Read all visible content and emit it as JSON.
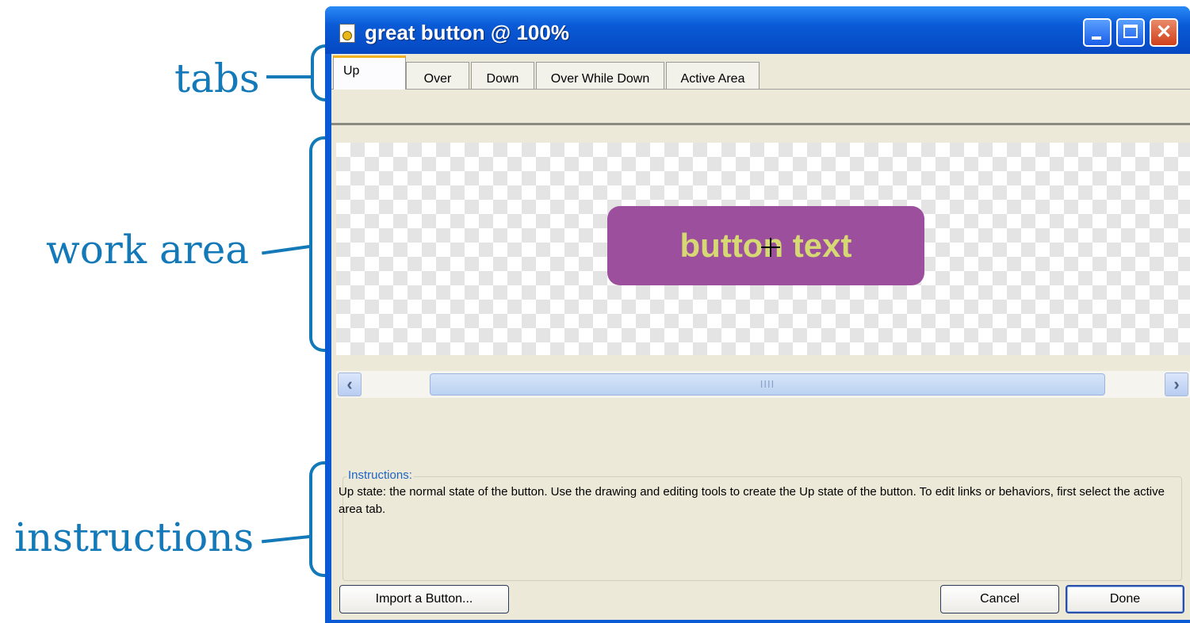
{
  "callouts": {
    "tabs": "tabs",
    "work_area": "work area",
    "instructions": "instructions"
  },
  "window": {
    "title": "great button @  100%",
    "controls": {
      "minimize": "minimize",
      "maximize": "maximize",
      "close": "✕"
    }
  },
  "tabs": [
    {
      "label": "Up",
      "active": true
    },
    {
      "label": "Over"
    },
    {
      "label": "Down"
    },
    {
      "label": "Over While Down"
    },
    {
      "label": "Active Area"
    }
  ],
  "work_area": {
    "button_text": "button text",
    "button_color": "#9c4f9c",
    "text_color": "#d6d873"
  },
  "scrollbar": {
    "left_arrow": "‹",
    "right_arrow": "›",
    "grip": "IIII"
  },
  "instructions": {
    "legend": "Instructions:",
    "text": "Up state: the normal state of the button. Use the drawing and editing tools to create the Up state of the button. To edit links or behaviors, first select the active area tab."
  },
  "footer": {
    "import_label": "Import a Button...",
    "cancel_label": "Cancel",
    "done_label": "Done"
  }
}
